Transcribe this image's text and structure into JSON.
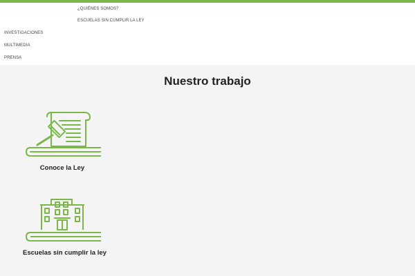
{
  "theme": {
    "accent": "#7ab648",
    "background": "#f4f4f4",
    "menu_bg": "#ffffff"
  },
  "menu": {
    "quienes": "¿QUIÉNES SOMOS?",
    "escuelas": "ESCUELAS SIN CUMPLIR LA LEY",
    "investigaciones": "INVESTIGACIONES",
    "multimedia": "MULTIMEDIA",
    "prensa": "PRENSA"
  },
  "main": {
    "title": "Nuestro trabajo",
    "cards": [
      {
        "label": "Conoce la Ley",
        "icon": "gavel-scroll-icon"
      },
      {
        "label": "Escuelas sin cumplir la ley",
        "icon": "school-building-icon"
      }
    ]
  }
}
